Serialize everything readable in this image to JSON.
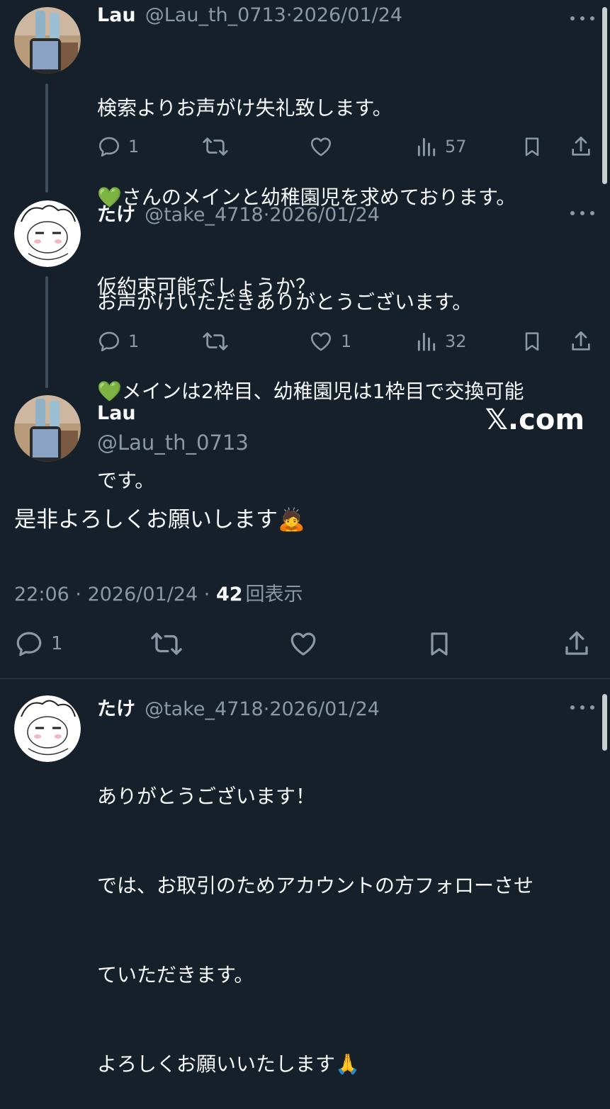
{
  "tweet1": {
    "name": "Lau",
    "handle": "@Lau_th_0713",
    "date": "2026/01/24",
    "lines": [
      "検索よりお声がけ失礼致します。",
      "💚さんのメインと幼稚園児を求めております。",
      "仮約束可能でしょうか？"
    ],
    "replies": "1",
    "retweets": "",
    "likes": "",
    "views": "57"
  },
  "tweet2": {
    "name": "たけ",
    "handle": "@take_4718",
    "date": "2026/01/24",
    "lines": [
      "お声がけいただきありがとうございます。",
      "💚メインは2枠目、幼稚園児は1枠目で交換可能",
      "です。"
    ],
    "replies": "1",
    "retweets": "",
    "likes": "1",
    "views": "32"
  },
  "main": {
    "name": "Lau",
    "handle": "@Lau_th_0713",
    "watermark": "𝕏.com",
    "text": "是非よろしくお願いします🙇",
    "time": "22:06",
    "date": "2026/01/24",
    "views_count": "42",
    "views_label": "回表示",
    "replies": "1"
  },
  "tweet3": {
    "name": "たけ",
    "handle": "@take_4718",
    "date": "2026/01/24",
    "lines": [
      "ありがとうございます！",
      "では、お取引のためアカウントの方フォローさせ",
      "ていただきます。",
      "よろしくお願いいたします🙏"
    ]
  },
  "colors": {
    "background": "#15202b",
    "text": "#f7f9f9",
    "muted": "#8b98a5",
    "thread_line": "#3e4d5a"
  },
  "icons": [
    "reply-icon",
    "retweet-icon",
    "like-icon",
    "views-icon",
    "bookmark-icon",
    "share-icon",
    "more-icon"
  ]
}
